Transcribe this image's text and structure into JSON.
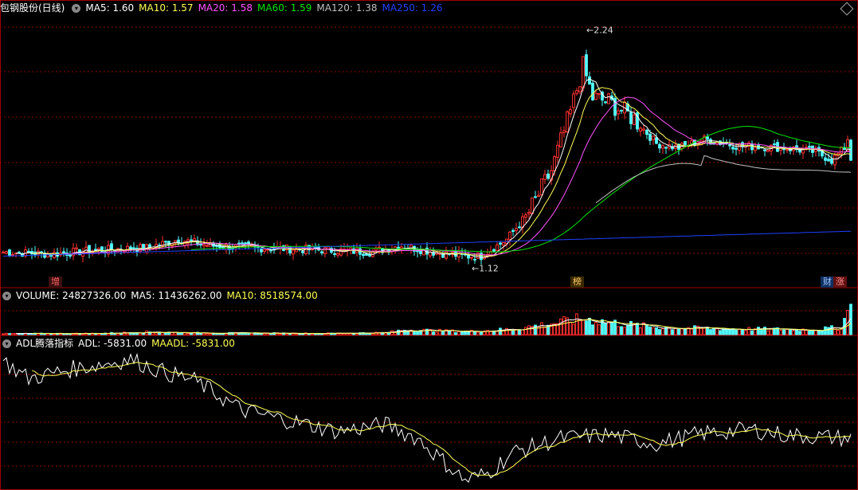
{
  "main_header": {
    "title": "包钢股份(日线)",
    "ma5_label": "MA5: 1.60",
    "ma10_label": "MA10: 1.57",
    "ma20_label": "MA20: 1.58",
    "ma60_label": "MA60: 1.59",
    "ma120_label": "MA120: 1.38",
    "ma250_label": "MA250: 1.26"
  },
  "volume_header": {
    "volume_label": "VOLUME: 24827326.00",
    "ma5_label": "MA5: 11436262.00",
    "ma10_label": "MA10: 8518574.00"
  },
  "adl_header": {
    "title": "ADL腾落指标",
    "adl_label": "ADL: -5831.00",
    "maadl_label": "MAADL: -5831.00"
  },
  "markers": {
    "high": "2.24",
    "low": "1.12",
    "tag_zeng": "增",
    "tag_bang": "榜",
    "tag_cai": "财",
    "tag_zhang": "涨"
  },
  "colors": {
    "up": "#ff3232",
    "down": "#54ffff",
    "ma5": "#ffffff",
    "ma10": "#ffff54",
    "ma20": "#ff54ff",
    "ma60": "#00e600",
    "ma120": "#c0c0c0",
    "ma250": "#2040ff",
    "grid": "#8b0000",
    "adl": "#ffffff",
    "maadl": "#ffff54"
  },
  "chart_data": {
    "type": "candlestick",
    "price_ylim": [
      1.05,
      2.3
    ],
    "high_price": 2.24,
    "low_price": 1.12,
    "current": {
      "close": 1.6,
      "ma5": 1.6,
      "ma10": 1.57,
      "ma20": 1.58,
      "ma60": 1.59,
      "ma120": 1.38,
      "ma250": 1.26
    },
    "price_keypoints": [
      [
        0,
        1.16
      ],
      [
        15,
        1.15
      ],
      [
        30,
        1.17
      ],
      [
        45,
        1.18
      ],
      [
        55,
        1.22
      ],
      [
        65,
        1.19
      ],
      [
        80,
        1.18
      ],
      [
        100,
        1.17
      ],
      [
        115,
        1.16
      ],
      [
        125,
        1.19
      ],
      [
        135,
        1.16
      ],
      [
        145,
        1.14
      ],
      [
        150,
        1.14
      ],
      [
        158,
        1.22
      ],
      [
        165,
        1.35
      ],
      [
        172,
        1.55
      ],
      [
        178,
        1.83
      ],
      [
        182,
        2.05
      ],
      [
        185,
        1.9
      ],
      [
        190,
        1.88
      ],
      [
        198,
        1.8
      ],
      [
        205,
        1.68
      ],
      [
        212,
        1.66
      ],
      [
        220,
        1.7
      ],
      [
        230,
        1.67
      ],
      [
        245,
        1.66
      ],
      [
        255,
        1.64
      ],
      [
        260,
        1.6
      ],
      [
        264,
        1.66
      ],
      [
        266,
        1.75
      ]
    ],
    "volume_keypoints": [
      [
        0,
        0.8
      ],
      [
        30,
        1.0
      ],
      [
        45,
        2.2
      ],
      [
        60,
        1.4
      ],
      [
        100,
        1.0
      ],
      [
        120,
        1.6
      ],
      [
        126,
        4.0
      ],
      [
        145,
        2.5
      ],
      [
        160,
        4.5
      ],
      [
        172,
        9
      ],
      [
        182,
        13
      ],
      [
        190,
        10
      ],
      [
        205,
        6
      ],
      [
        220,
        5
      ],
      [
        235,
        4.5
      ],
      [
        255,
        4.0
      ],
      [
        263,
        6
      ],
      [
        266,
        24.8
      ]
    ],
    "adl_keypoints": [
      [
        0,
        200
      ],
      [
        8,
        -300
      ],
      [
        20,
        -50
      ],
      [
        40,
        250
      ],
      [
        50,
        -100
      ],
      [
        60,
        -350
      ],
      [
        75,
        -1200
      ],
      [
        90,
        -1500
      ],
      [
        105,
        -1800
      ],
      [
        120,
        -1600
      ],
      [
        130,
        -2000
      ],
      [
        145,
        -3200
      ],
      [
        152,
        -3000
      ],
      [
        160,
        -2400
      ],
      [
        175,
        -2000
      ],
      [
        190,
        -1900
      ],
      [
        205,
        -2150
      ],
      [
        220,
        -1850
      ],
      [
        235,
        -1750
      ],
      [
        245,
        -1900
      ],
      [
        255,
        -1950
      ],
      [
        266,
        -2000
      ]
    ]
  }
}
